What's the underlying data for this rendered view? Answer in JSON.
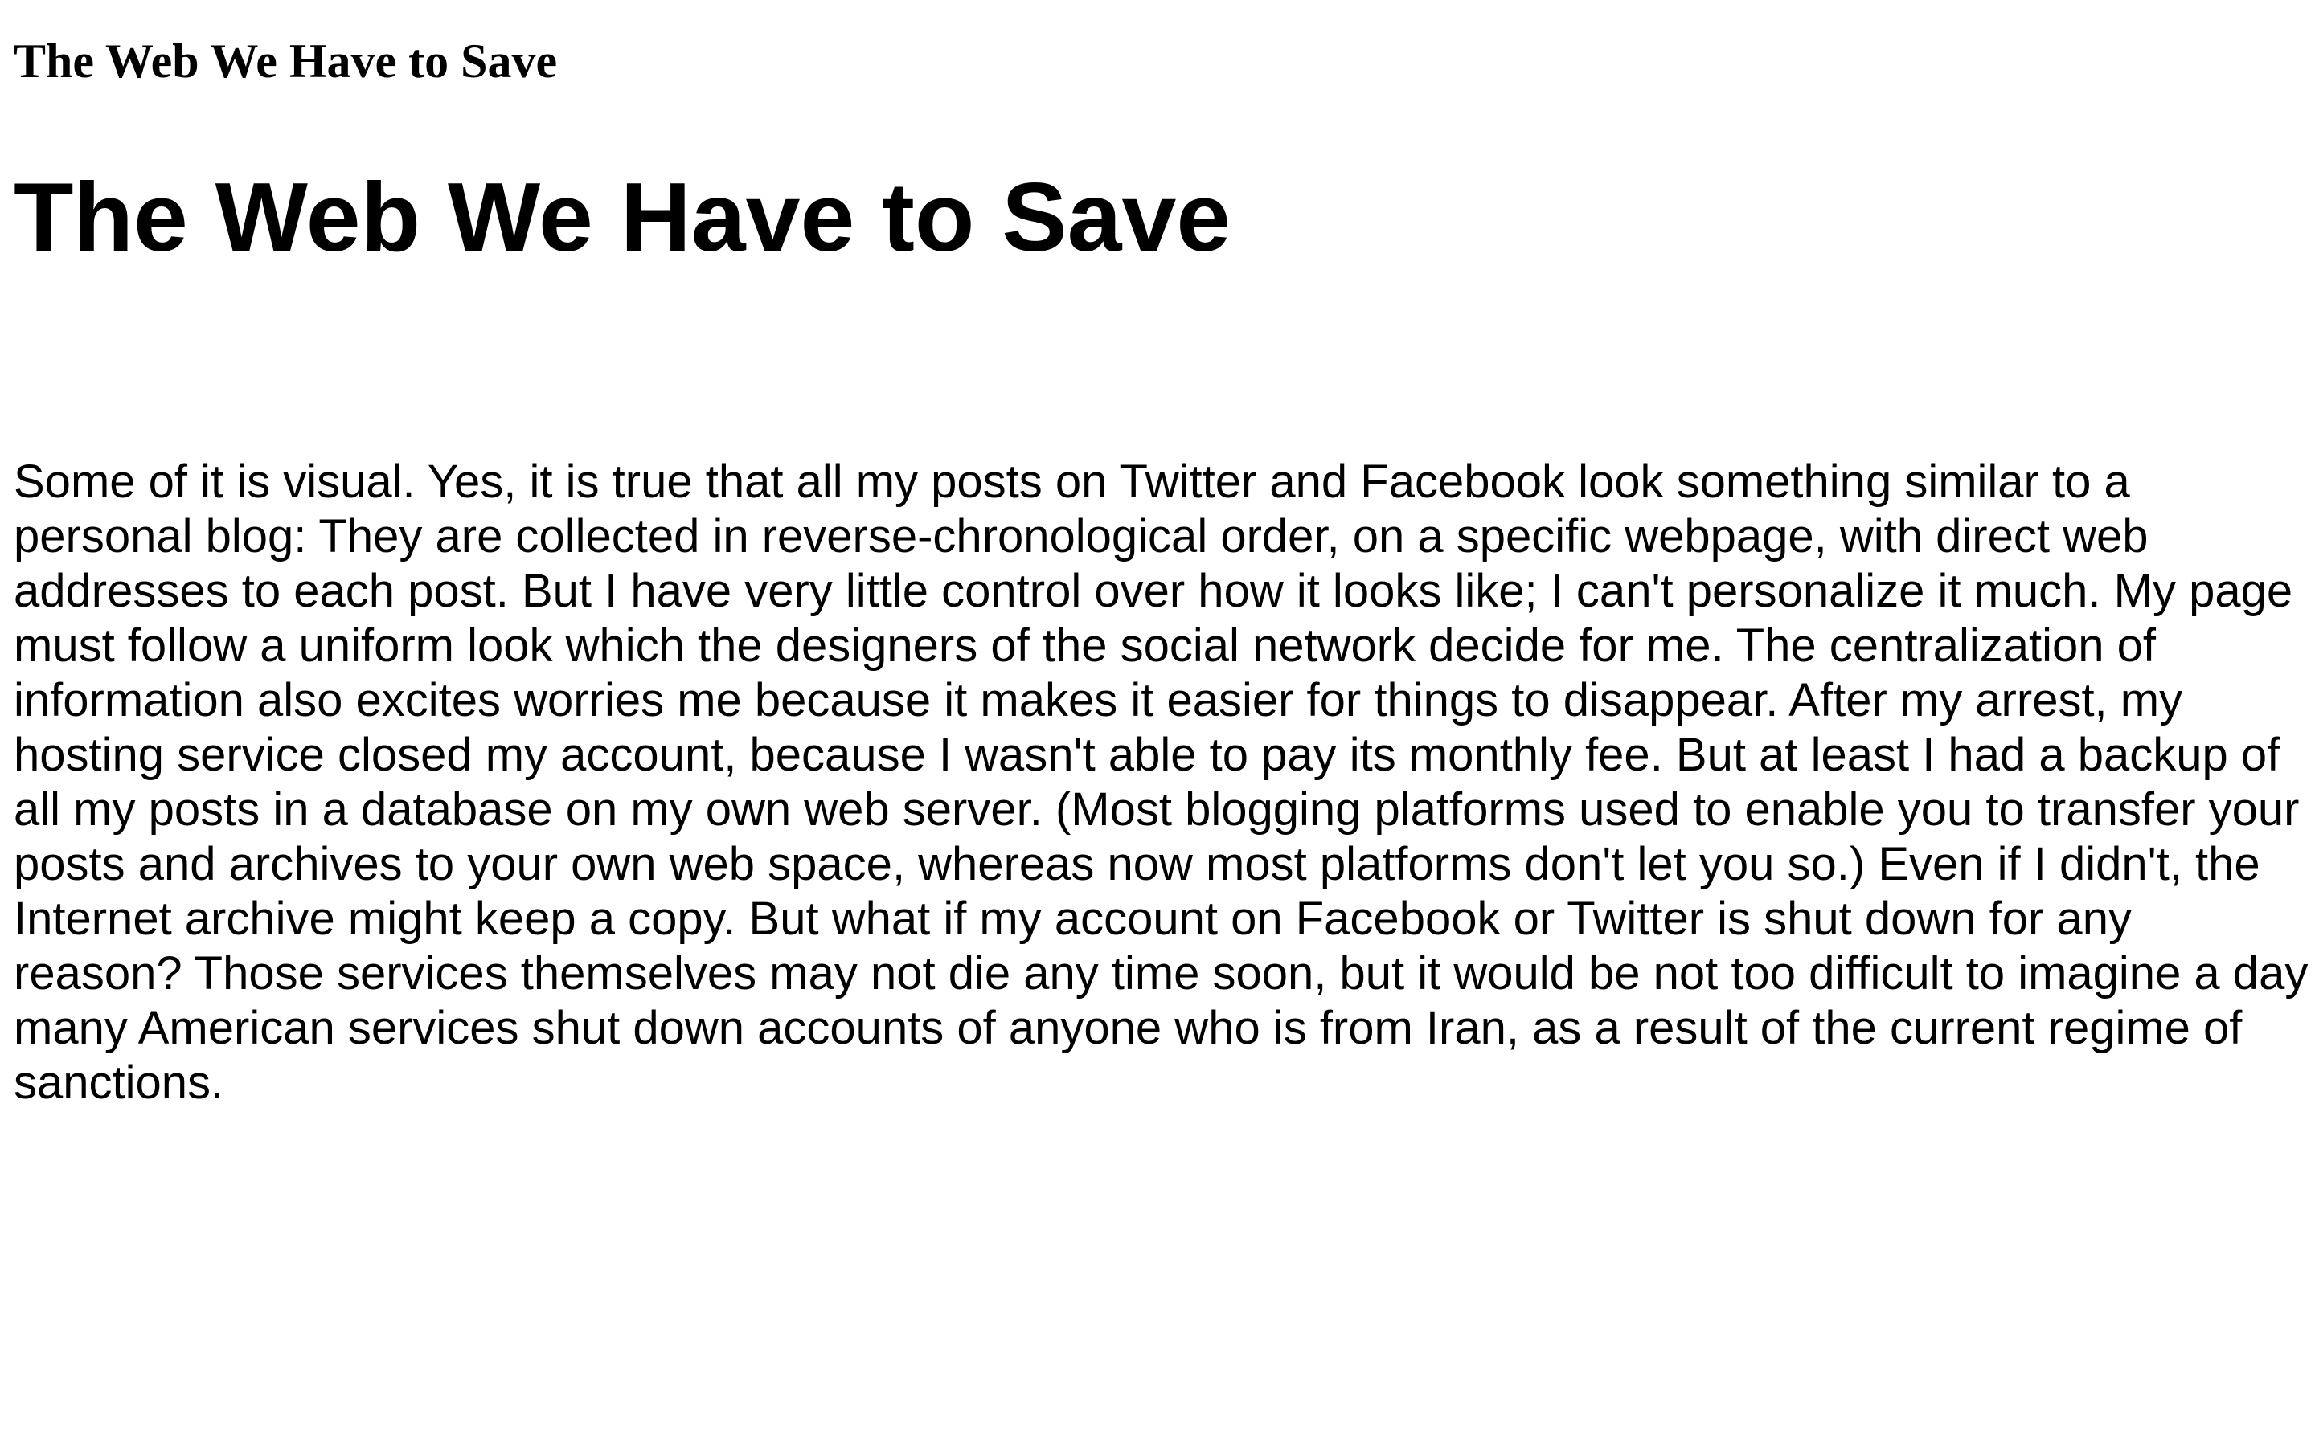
{
  "site": {
    "title": "The Web We Have to Save"
  },
  "article": {
    "heading": "The Web We Have to Save",
    "paragraph": "Some of it is visual. Yes, it is true that all my posts on Twitter and Facebook look something similar to a personal blog: They are collected in reverse-chronological order, on a specific webpage, with direct web addresses to each post. But I have very little control over how it looks like; I can't personalize it much. My page must follow a uniform look which the designers of the social network decide for me. The centralization of information also excites worries me because it makes it easier for things to disappear. After my arrest, my hosting service closed my account, because I wasn't able to pay its monthly fee. But at least I had a backup of all my posts in a database on my own web server. (Most blogging platforms used to enable you to transfer your posts and archives to your own web space, whereas now most platforms don't let you so.) Even if I didn't, the Internet archive might keep a copy. But what if my account on Facebook or Twitter is shut down for any reason? Those services themselves may not die any time soon, but it would be not too difficult to imagine a day many American services shut down accounts of anyone who is from Iran, as a result of the current regime of sanctions."
  }
}
